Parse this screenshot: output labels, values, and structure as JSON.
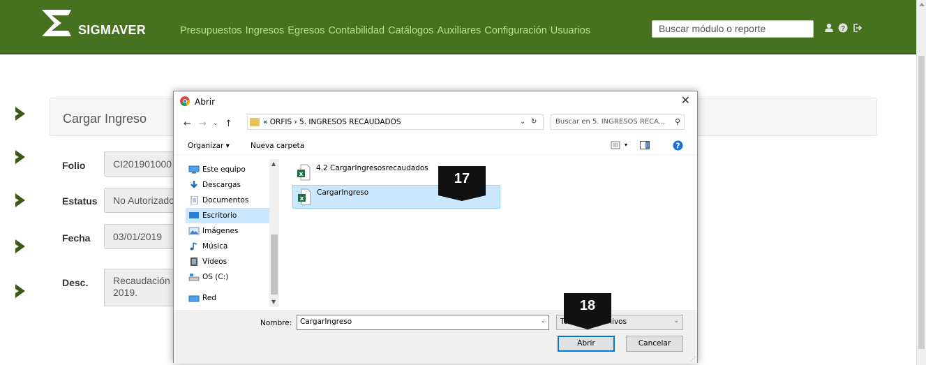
{
  "app": {
    "brand": "SIGMAVER",
    "nav": [
      "Presupuestos",
      "Ingresos",
      "Egresos",
      "Contabilidad",
      "Catálogos",
      "Auxiliares",
      "Configuración",
      "Usuarios"
    ],
    "search_placeholder": "Buscar módulo o reporte",
    "icons": [
      "user-icon",
      "help-icon",
      "logout-icon"
    ]
  },
  "page": {
    "title": "Cargar Ingreso",
    "fields": [
      {
        "label": "Folio",
        "value": "CI201901000"
      },
      {
        "label": "Estatus",
        "value": "No Autorizado"
      },
      {
        "label": "Fecha",
        "value": "03/01/2019"
      },
      {
        "label": "Desc.",
        "value": "Recaudación",
        "value2": "2019."
      }
    ]
  },
  "dialog": {
    "title": "Abrir",
    "path": "« ORFIS › 5. INGRESOS RECAUDADOS",
    "search_placeholder": "Buscar en 5. INGRESOS RECA...",
    "toolbar": {
      "organize": "Organizar ▾",
      "new_folder": "Nueva carpeta"
    },
    "tree": [
      "Este equipo",
      "Descargas",
      "Documentos",
      "Escritorio",
      "Imágenes",
      "Música",
      "Vídeos",
      "OS (C:)",
      "Red"
    ],
    "tree_selected": "Escritorio",
    "files": [
      "4.2 CargarIngresosrecaudados",
      "CargarIngreso"
    ],
    "file_selected": "CargarIngreso",
    "name_label": "Nombre:",
    "name_value": "CargarIngreso",
    "type_value": "Todos los archivos",
    "open_label": "Abrir",
    "cancel_label": "Cancelar"
  },
  "callouts": [
    "17",
    "18"
  ],
  "colors": {
    "topbar": "#46711f",
    "nav_text": "#b7e48a",
    "chevron": "#3a5a18",
    "selection": "#cce8ff",
    "accent": "#0078d7"
  }
}
